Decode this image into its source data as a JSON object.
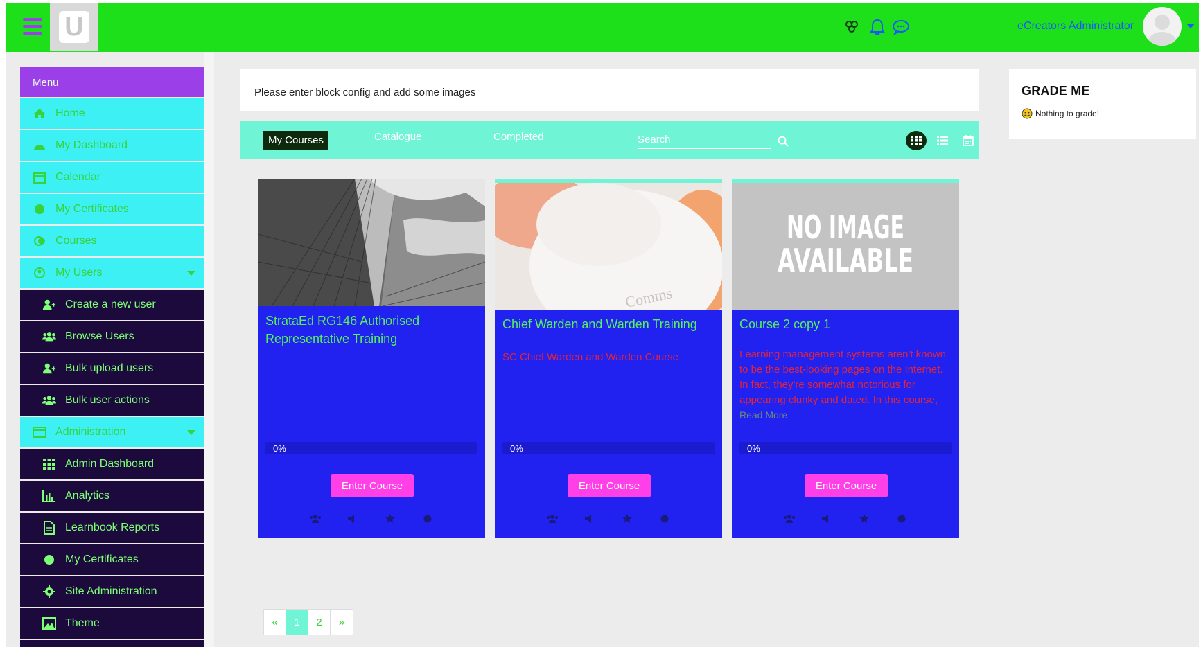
{
  "header": {
    "logo_letter": "U",
    "username": "eCreators Administrator",
    "icons": [
      "users-icon",
      "bell-icon",
      "chat-icon"
    ],
    "brand_color": "#1ee01a"
  },
  "sidebar": {
    "menu_title": "Menu",
    "items": [
      {
        "label": "Home",
        "icon": "home-icon"
      },
      {
        "label": "My Dashboard",
        "icon": "dashboard-icon"
      },
      {
        "label": "Calendar",
        "icon": "calendar-icon"
      },
      {
        "label": "My Certificates",
        "icon": "certificate-icon"
      },
      {
        "label": "Courses",
        "icon": "courses-icon"
      },
      {
        "label": "My Users",
        "icon": "users-icon"
      },
      {
        "label": "Create a new user",
        "icon": "add-user-icon"
      },
      {
        "label": "Browse Users",
        "icon": "users-group-icon"
      },
      {
        "label": "Bulk upload users",
        "icon": "add-user-icon"
      },
      {
        "label": "Bulk user actions",
        "icon": "users-group-icon"
      },
      {
        "label": "Administration",
        "icon": "admin-icon"
      },
      {
        "label": "Admin Dashboard",
        "icon": "grid-icon"
      },
      {
        "label": "Analytics",
        "icon": "bar-chart-icon"
      },
      {
        "label": "Learnbook Reports",
        "icon": "report-icon"
      },
      {
        "label": "My Certificates",
        "icon": "certificate-icon"
      },
      {
        "label": "Site Administration",
        "icon": "gear-icon"
      },
      {
        "label": "Theme",
        "icon": "image-icon"
      }
    ]
  },
  "notice": {
    "text": "Please enter block config and add some images"
  },
  "tabs": {
    "my_courses": "My Courses",
    "catalogue": "Catalogue",
    "completed": "Completed",
    "search_placeholder": "Search"
  },
  "courses": [
    {
      "title": "StrataEd RG146 Authorised Representative Training",
      "description": "",
      "progress_label": "0%",
      "progress": 0,
      "button": "Enter Course",
      "image": "building-photo"
    },
    {
      "title": "Chief Warden and Warden Training",
      "description": "SC Chief Warden and Warden Course",
      "progress_label": "0%",
      "progress": 0,
      "button": "Enter Course",
      "image": "hard-hat-photo",
      "image_text": "Comms"
    },
    {
      "title": "Course 2 copy 1",
      "description": "Learning management systems aren't known to be the best-looking pages on the Internet. In fact, they're somewhat notorious for appearing clunky and dated. In this course,",
      "read_more": "Read More",
      "progress_label": "0%",
      "progress": 0,
      "button": "Enter Course",
      "image": "no-image-placeholder",
      "image_text_line1": "NO IMAGE",
      "image_text_line2": "AVAILABLE"
    }
  ],
  "pagination": {
    "prev": "«",
    "pages": [
      "1",
      "2"
    ],
    "next": "»",
    "current": "1"
  },
  "grade_block": {
    "title": "GRADE ME",
    "message": "Nothing to grade!"
  }
}
